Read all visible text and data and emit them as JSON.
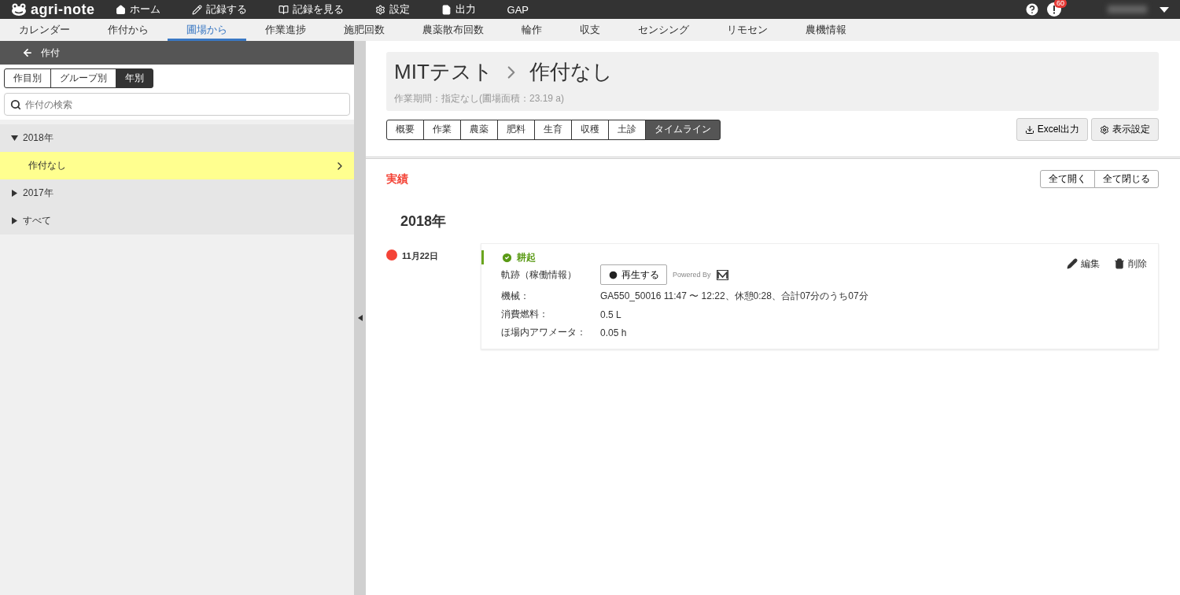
{
  "app": {
    "logo": "agri-note",
    "badge_count": "60"
  },
  "nav": [
    {
      "label": "ホーム",
      "kind": "home"
    },
    {
      "label": "記録する",
      "kind": "record"
    },
    {
      "label": "記録を見る",
      "kind": "view"
    },
    {
      "label": "設定",
      "kind": "settings"
    },
    {
      "label": "出力",
      "kind": "export"
    },
    {
      "label": "GAP",
      "kind": "text"
    }
  ],
  "subnav": [
    {
      "label": "カレンダー",
      "selected": false
    },
    {
      "label": "作付から",
      "selected": false
    },
    {
      "label": "圃場から",
      "selected": true
    },
    {
      "label": "作業進捗",
      "selected": false
    },
    {
      "label": "施肥回数",
      "selected": false
    },
    {
      "label": "農薬散布回数",
      "selected": false
    },
    {
      "label": "輪作",
      "selected": false
    },
    {
      "label": "収支",
      "selected": false
    },
    {
      "label": "センシング",
      "selected": false
    },
    {
      "label": "リモセン",
      "selected": false
    },
    {
      "label": "農機情報",
      "selected": false
    }
  ],
  "sidebar": {
    "title": "作付",
    "views": [
      {
        "label": "作目別",
        "selected": false
      },
      {
        "label": "グループ別",
        "selected": false
      },
      {
        "label": "年別",
        "selected": true
      }
    ],
    "search": {
      "placeholder": "作付の検索"
    },
    "tree": [
      {
        "label": "2018年",
        "expanded": true,
        "children": [
          {
            "label": "作付なし",
            "selected": true
          }
        ]
      },
      {
        "label": "2017年",
        "expanded": false
      },
      {
        "label": "すべて",
        "expanded": false
      }
    ]
  },
  "header": {
    "field": "MITテスト",
    "crop": "作付なし",
    "subtitle": "作業期間：指定なし(圃場面積：23.19 a)"
  },
  "tabs": [
    {
      "label": "概要",
      "selected": false
    },
    {
      "label": "作業",
      "selected": false
    },
    {
      "label": "農薬",
      "selected": false
    },
    {
      "label": "肥料",
      "selected": false
    },
    {
      "label": "生育",
      "selected": false
    },
    {
      "label": "収穫",
      "selected": false
    },
    {
      "label": "土診",
      "selected": false
    },
    {
      "label": "タイムライン",
      "selected": true
    }
  ],
  "actions": [
    {
      "label": "Excel出力",
      "kind": "export"
    },
    {
      "label": "表示設定",
      "kind": "settings"
    }
  ],
  "section": {
    "title": "実績",
    "buttons": [
      "全て開く",
      "全て閉じる"
    ]
  },
  "year": "2018年",
  "entries": [
    {
      "date": "11月22日",
      "color": "#f44336",
      "work": "耕起",
      "done": true,
      "edit": "編集",
      "delete": "削除",
      "track": {
        "label": "軌跡（稼働情報）",
        "play": "再生する",
        "powered": "Powered By"
      },
      "details": [
        {
          "label": "機械：",
          "value": "GA550_50016 11:47 〜 12:22、休憩0:28、合計07分のうち07分"
        },
        {
          "label": "消費燃料：",
          "value": "0.5 L"
        },
        {
          "label": "ほ場内アワメータ：",
          "value": "0.05 h"
        }
      ]
    }
  ]
}
